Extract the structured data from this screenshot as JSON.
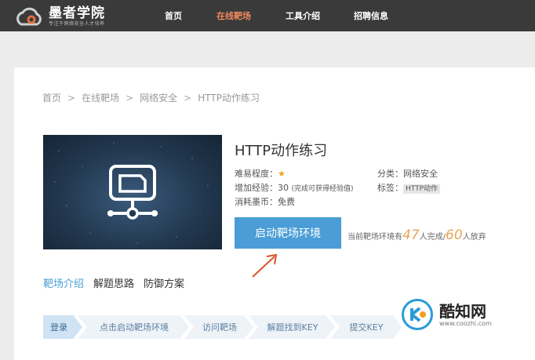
{
  "header": {
    "logo_title": "墨者学院",
    "logo_sub": "专注于网络安全人才培养",
    "nav": [
      {
        "label": "首页"
      },
      {
        "label": "在线靶场"
      },
      {
        "label": "工具介绍"
      },
      {
        "label": "招聘信息"
      }
    ],
    "active_color": "#f08a5d"
  },
  "breadcrumb": [
    "首页",
    ">",
    "在线靶场",
    ">",
    "网络安全",
    ">",
    "HTTP动作练习"
  ],
  "detail": {
    "title": "HTTP动作练习",
    "difficulty_label": "难易程度：",
    "difficulty_star": "★",
    "exp_label": "增加经验：30",
    "exp_note": "(完成可获得经验值)",
    "cost_label": "消耗墨币：免费",
    "category_label": "分类：网络安全",
    "tag_label": "标签：",
    "tag_value": "HTTP动作"
  },
  "start_button": "启动靶场环境",
  "stats": {
    "prefix": "当前靶场环境有",
    "completed": "47",
    "mid": "人完成/",
    "abandoned": "60",
    "suffix": "人放弃"
  },
  "tabs": [
    {
      "label": "靶场介绍"
    },
    {
      "label": "解题思路"
    },
    {
      "label": "防御方案"
    }
  ],
  "steps": [
    {
      "label": "登录"
    },
    {
      "label": "点击启动靶场环境"
    },
    {
      "label": "访问靶场"
    },
    {
      "label": "解题找到KEY"
    },
    {
      "label": "提交KEY"
    }
  ],
  "watermark": {
    "title": "酷知网",
    "url": "www.coozhi.com"
  },
  "colors": {
    "accent": "#4a9dd6",
    "topbar": "#3a3a3a",
    "stats_highlight": "#e8a558"
  }
}
